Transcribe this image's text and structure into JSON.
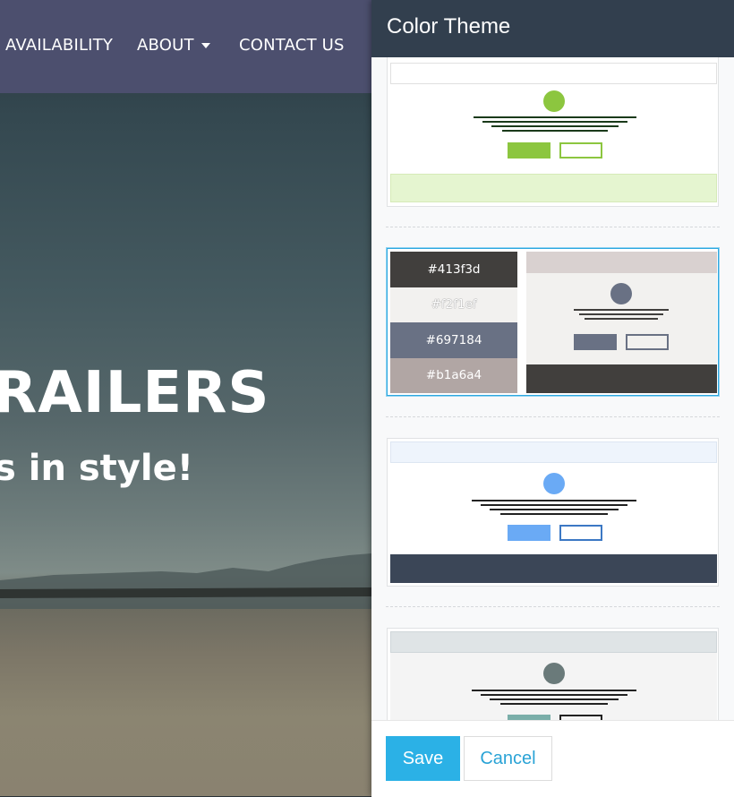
{
  "nav": {
    "items": [
      {
        "label": "AVAILABILITY"
      },
      {
        "label": "ABOUT"
      },
      {
        "label": "CONTACT US"
      }
    ]
  },
  "hero": {
    "title": "RAILERS",
    "subtitle": "s in style!"
  },
  "panel": {
    "title": "Color Theme",
    "save_label": "Save",
    "cancel_label": "Cancel"
  },
  "themes": [
    {
      "accent": "#8cc63f",
      "top": "#ffffff",
      "bg": "#ffffff",
      "bottom": "#e5f5d0",
      "lines": "#1a3a1a",
      "outline": "#8cc63f"
    },
    {
      "accent": "#697184",
      "top": "#d9d1d0",
      "bg": "#f2f1ef",
      "bottom": "#413f3d",
      "lines": "#413f3d",
      "outline": "#697184",
      "selected": true,
      "swatches": [
        {
          "hex": "#413f3d",
          "text_color": "#ffffff"
        },
        {
          "hex": "#f2f1ef",
          "text_color": "#ffffff"
        },
        {
          "hex": "#697184",
          "text_color": "#ffffff"
        },
        {
          "hex": "#b1a6a4",
          "text_color": "#ffffff"
        }
      ]
    },
    {
      "accent": "#6aaaf5",
      "top": "#eef4fc",
      "bg": "#ffffff",
      "bottom": "#3b4657",
      "lines": "#222222",
      "outline": "#3c78c4"
    },
    {
      "accent": "#6a7a7a",
      "top": "#dfe4e6",
      "bg": "#f4f4f4",
      "bottom": "#333333",
      "lines": "#222222",
      "outline": "#222222",
      "btn_fill": "#7aaea9"
    }
  ]
}
